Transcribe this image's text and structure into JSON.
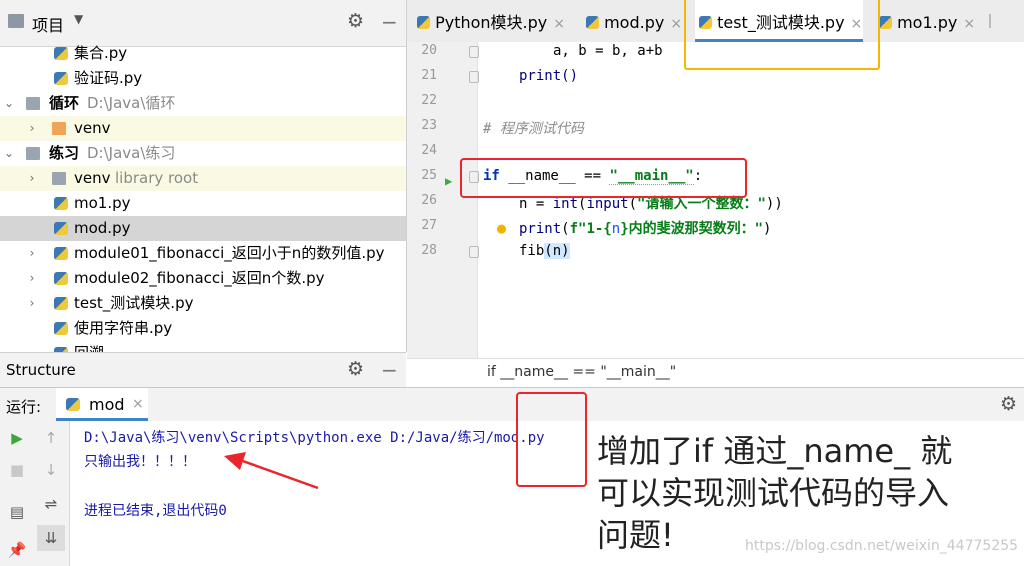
{
  "project_panel": {
    "title": "项目",
    "items": [
      {
        "label": "集合.py",
        "kind": "py"
      },
      {
        "label": "验证码.py",
        "kind": "py"
      },
      {
        "label": "循环",
        "path": "D:\\Java\\循环",
        "kind": "folder"
      },
      {
        "label": "venv",
        "kind": "venv"
      },
      {
        "label": "练习",
        "path": "D:\\Java\\练习",
        "kind": "folder"
      },
      {
        "label": "venv",
        "note": "library root",
        "kind": "venv"
      },
      {
        "label": "mo1.py",
        "kind": "py"
      },
      {
        "label": "mod.py",
        "kind": "py",
        "selected": true
      },
      {
        "label": "module01_fibonacci_返回小于n的数列值.py",
        "kind": "py"
      },
      {
        "label": "module02_fibonacci_返回n个数.py",
        "kind": "py"
      },
      {
        "label": "test_测试模块.py",
        "kind": "py"
      },
      {
        "label": "使用字符串.py",
        "kind": "py"
      },
      {
        "label": "回溯",
        "kind": "py"
      }
    ]
  },
  "structure_panel": {
    "title": "Structure"
  },
  "editor": {
    "tabs": [
      {
        "label": "Python模块.py",
        "closable": "×"
      },
      {
        "label": "mod.py",
        "closable": "×"
      },
      {
        "label": "test_测试模块.py",
        "closable": "×",
        "active": true
      },
      {
        "label": "mo1.py",
        "closable": "×"
      }
    ],
    "line_numbers": [
      "20",
      "21",
      "22",
      "23",
      "24",
      "25",
      "26",
      "27",
      "28"
    ],
    "lines": {
      "l20": "a, b = b, a+b",
      "l21": "print()",
      "l23": "# 程序测试代码",
      "l25_kw": "if",
      "l25_mid": " __name__ == ",
      "l25_str": "\"__main__\"",
      "l25_end": ":",
      "l26_pre": "n = ",
      "l26_int": "int",
      "l26_p1": "(",
      "l26_input": "input",
      "l26_p2": "(",
      "l26_str": "\"请输入一个整数：\"",
      "l26_end": "))",
      "l27_print": "print",
      "l27_p1": "(",
      "l27_f": "f\"1-{",
      "l27_n": "n",
      "l27_rest": "}内的斐波那契数列：\"",
      "l27_end": ")",
      "l28_fn": "fib",
      "l28_arg": "(n)"
    },
    "breadcrumb": "if __name__ == \"__main__\""
  },
  "run_panel": {
    "label": "运行:",
    "tab": "mod",
    "output": [
      "D:\\Java\\练习\\venv\\Scripts\\python.exe D:/Java/练习/mod.py",
      "只输出我！！！！",
      "",
      "进程已结束,退出代码0"
    ]
  },
  "annotation": {
    "note": "增加了if 通过_name_ 就可以实现测试代码的导入问题!",
    "watermark": "https://blog.csdn.net/weixin_44775255"
  },
  "colors": {
    "annotation_red": "#e8262b",
    "highlight_yellow": "#f5b800",
    "tree_highlight": "#fafae4",
    "selected_row": "#d5d5d5"
  }
}
